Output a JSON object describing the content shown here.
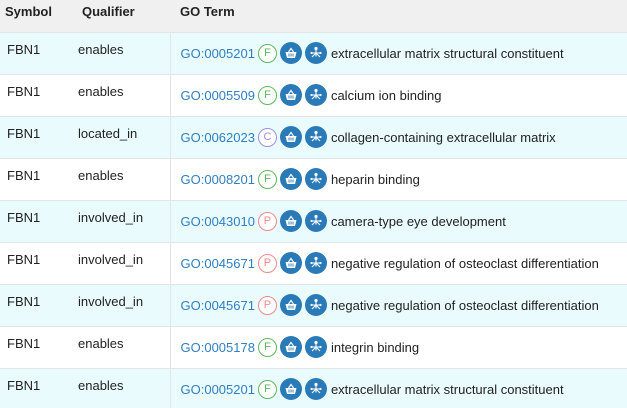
{
  "table": {
    "headers": {
      "symbol": "Symbol",
      "qualifier": "Qualifier",
      "go_term": "GO Term"
    },
    "rows": [
      {
        "symbol": "FBN1",
        "qualifier": "enables",
        "go_id": "GO:0005201",
        "aspect": "F",
        "term": "extracellular matrix structural constituent"
      },
      {
        "symbol": "FBN1",
        "qualifier": "enables",
        "go_id": "GO:0005509",
        "aspect": "F",
        "term": "calcium ion binding"
      },
      {
        "symbol": "FBN1",
        "qualifier": "located_in",
        "go_id": "GO:0062023",
        "aspect": "C",
        "term": "collagen-containing extracellular matrix"
      },
      {
        "symbol": "FBN1",
        "qualifier": "enables",
        "go_id": "GO:0008201",
        "aspect": "F",
        "term": "heparin binding"
      },
      {
        "symbol": "FBN1",
        "qualifier": "involved_in",
        "go_id": "GO:0043010",
        "aspect": "P",
        "term": "camera-type eye development"
      },
      {
        "symbol": "FBN1",
        "qualifier": "involved_in",
        "go_id": "GO:0045671",
        "aspect": "P",
        "term": "negative regulation of osteoclast differentiation"
      },
      {
        "symbol": "FBN1",
        "qualifier": "involved_in",
        "go_id": "GO:0045671",
        "aspect": "P",
        "term": "negative regulation of osteoclast differentiation"
      },
      {
        "symbol": "FBN1",
        "qualifier": "enables",
        "go_id": "GO:0005178",
        "aspect": "F",
        "term": "integrin binding"
      },
      {
        "symbol": "FBN1",
        "qualifier": "enables",
        "go_id": "GO:0005201",
        "aspect": "F",
        "term": "extracellular matrix structural constituent"
      }
    ]
  },
  "icons": {
    "basket": "basket-icon",
    "hierarchy": "hierarchy-icon"
  },
  "colors": {
    "link": "#2f7fc1",
    "button": "#2a7ab8",
    "row_alt": "#e9fbfd",
    "header_bg": "#f0f0f0",
    "aspect_F": "#5cb85c",
    "aspect_C": "#9a8fe0",
    "aspect_P": "#f08a8a"
  }
}
